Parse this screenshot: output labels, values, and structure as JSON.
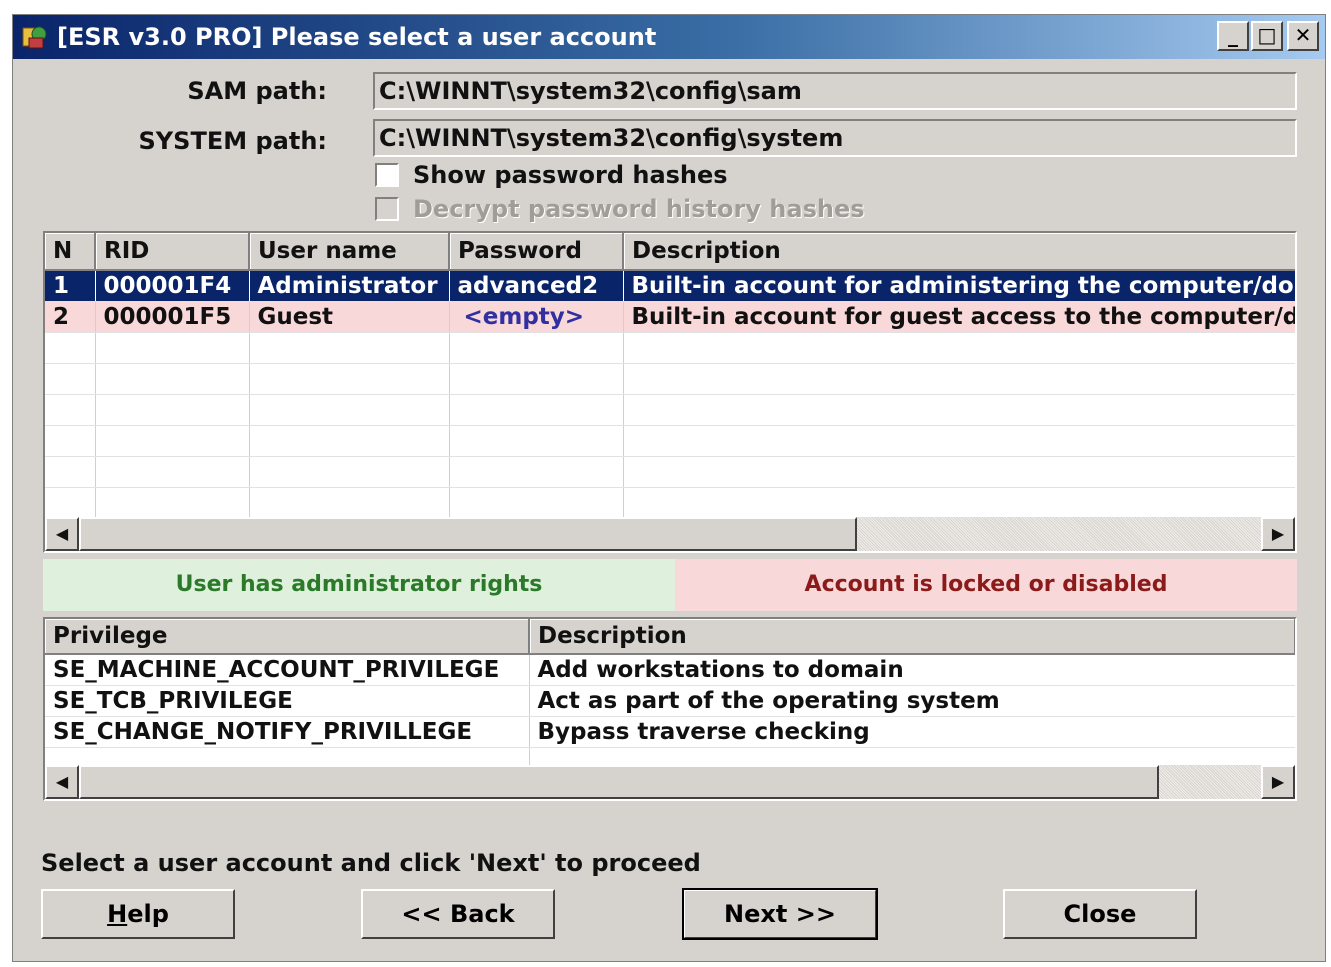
{
  "window": {
    "title": "[ESR v3.0 PRO]  Please select a user account",
    "controls": {
      "minimize": "_",
      "maximize": "□",
      "close": "✕"
    }
  },
  "paths": {
    "sam_label": "SAM path:",
    "sam_value": "C:\\WINNT\\system32\\config\\sam",
    "system_label": "SYSTEM path:",
    "system_value": "C:\\WINNT\\system32\\config\\system"
  },
  "options": {
    "show_hashes": {
      "label": "Show password hashes",
      "checked": false
    },
    "decrypt_history": {
      "label": "Decrypt password history hashes",
      "checked": false,
      "enabled": false
    }
  },
  "users": {
    "columns": [
      "N",
      "RID",
      "User name",
      "Password",
      "Description"
    ],
    "rows": [
      {
        "n": "1",
        "rid": "000001F4",
        "username": "Administrator",
        "password": "advanced2",
        "description": "Built-in account for administering the computer/domain",
        "state": "selected"
      },
      {
        "n": "2",
        "rid": "000001F5",
        "username": "Guest",
        "password": "<empty>",
        "description": "Built-in account for guest access to the computer/domain",
        "state": "locked"
      }
    ]
  },
  "legend": {
    "admin_text": "User has administrator rights",
    "admin_color": "#2a7a2a",
    "admin_bg": "#dff0dc",
    "locked_text": "Account is locked or disabled",
    "locked_color": "#8b1a1a",
    "locked_bg": "#f8d8d8"
  },
  "privileges": {
    "columns": [
      "Privilege",
      "Description"
    ],
    "rows": [
      {
        "privilege": "SE_MACHINE_ACCOUNT_PRIVILEGE",
        "description": "Add workstations to domain"
      },
      {
        "privilege": "SE_TCB_PRIVILEGE",
        "description": "Act as part of the operating system"
      },
      {
        "privilege": "SE_CHANGE_NOTIFY_PRIVILLEGE",
        "description": "Bypass traverse checking"
      }
    ]
  },
  "hint": "Select a user account and click 'Next' to proceed",
  "buttons": {
    "help_rest": "elp",
    "back": "<< Back",
    "next": "Next >>",
    "close": "Close"
  }
}
